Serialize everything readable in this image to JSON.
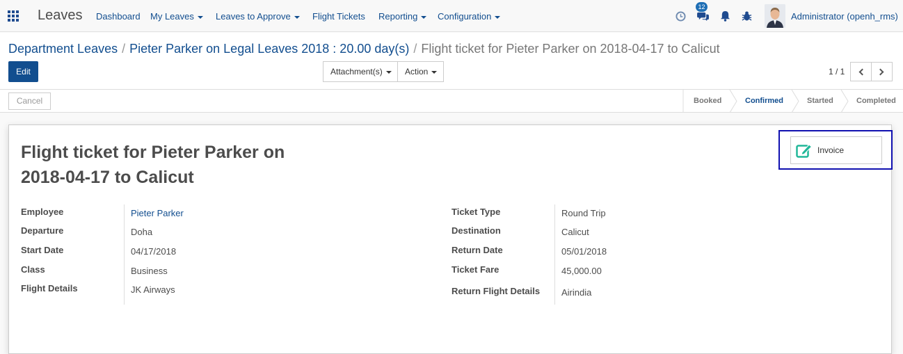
{
  "navbar": {
    "app_name": "Leaves",
    "menus": [
      "Dashboard",
      "My Leaves",
      "Leaves to Approve",
      "Flight Tickets",
      "Reporting",
      "Configuration"
    ],
    "message_count": "12",
    "user_name": "Administrator (openh_rms)"
  },
  "breadcrumb": {
    "root": "Department Leaves",
    "parent": "Pieter Parker on Legal Leaves 2018 : 20.00 day(s)",
    "current": "Flight ticket for Pieter Parker on 2018-04-17 to Calicut"
  },
  "toolbar": {
    "edit_label": "Edit",
    "attachments_label": "Attachment(s)",
    "action_label": "Action",
    "pager": "1 / 1"
  },
  "statusbar": {
    "cancel_label": "Cancel",
    "stages": [
      "Booked",
      "Confirmed",
      "Started",
      "Completed"
    ],
    "active_stage": "Confirmed"
  },
  "form": {
    "title_line1": "Flight ticket for Pieter Parker on",
    "title_line2": "2018-04-17 to Calicut",
    "invoice_label": "Invoice",
    "left": [
      {
        "label": "Employee",
        "value": "Pieter Parker"
      },
      {
        "label": "Departure",
        "value": "Doha"
      },
      {
        "label": "Start Date",
        "value": "04/17/2018"
      },
      {
        "label": "Class",
        "value": "Business"
      },
      {
        "label": "Flight Details",
        "value": "JK Airways"
      }
    ],
    "right": [
      {
        "label": "Ticket Type",
        "value": "Round Trip"
      },
      {
        "label": "Destination",
        "value": "Calicut"
      },
      {
        "label": "Return Date",
        "value": "05/01/2018"
      },
      {
        "label": "Ticket Fare",
        "value": "45,000.00"
      },
      {
        "label": "Return Flight Details",
        "value": "Airindia"
      }
    ]
  },
  "colors": {
    "brand": "#124e8f",
    "highlight_border": "#1010b0",
    "invoice_icon": "#21b799"
  },
  "icons": [
    "apps-grid-icon",
    "clock-icon",
    "chat-icon",
    "bell-icon",
    "bug-icon",
    "chevron-left-icon",
    "chevron-right-icon",
    "edit-icon"
  ]
}
